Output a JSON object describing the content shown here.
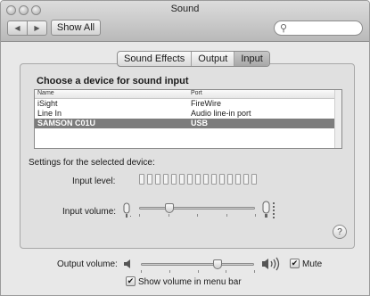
{
  "window": {
    "title": "Sound"
  },
  "toolbar": {
    "back_glyph": "◀",
    "forward_glyph": "▶",
    "show_all_label": "Show All",
    "search_placeholder": ""
  },
  "tabs": [
    {
      "label": "Sound Effects",
      "active": false
    },
    {
      "label": "Output",
      "active": false
    },
    {
      "label": "Input",
      "active": true
    }
  ],
  "input": {
    "heading": "Choose a device for sound input",
    "columns": {
      "name": "Name",
      "port": "Port"
    },
    "devices": [
      {
        "name": "iSight",
        "port": "FireWire",
        "selected": false
      },
      {
        "name": "Line In",
        "port": "Audio line-in port",
        "selected": false
      },
      {
        "name": "SAMSON C01U",
        "port": "USB",
        "selected": true
      }
    ],
    "settings_label": "Settings for the selected device:",
    "input_level_label": "Input level:",
    "input_level_segments": 15,
    "input_level_lit": 0,
    "input_volume_label": "Input volume:",
    "input_volume": 0.26
  },
  "help_glyph": "?",
  "output": {
    "volume_label": "Output volume:",
    "volume": 0.68,
    "mute_label": "Mute",
    "mute_checked": true,
    "menu_bar_label": "Show volume in menu bar",
    "menu_bar_checked": true
  },
  "icons": {
    "search": "search-icon",
    "mic_low": "microphone-low-icon",
    "mic_high": "microphone-high-icon",
    "speaker_low": "speaker-low-icon",
    "speaker_high": "speaker-high-icon"
  }
}
